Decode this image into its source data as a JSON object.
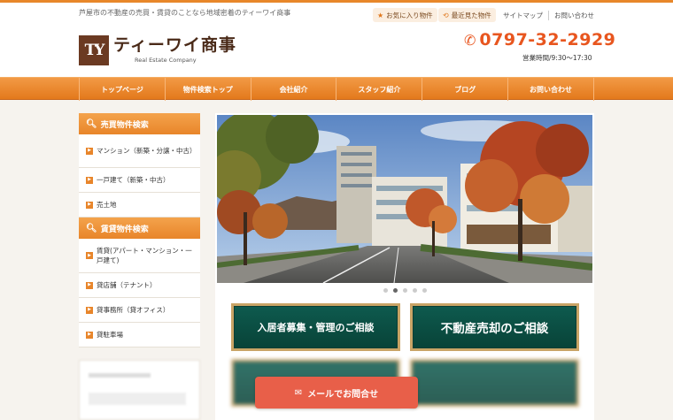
{
  "header": {
    "tagline": "芦屋市の不動産の売買・賃貸のことなら地域密着のティーワイ商事",
    "logo_mark": "TY",
    "logo_name": "ティーワイ商事",
    "logo_sub": "Real Estate Company",
    "utility": {
      "favorites": "お気に入り物件",
      "recent": "最近見た物件",
      "sitemap": "サイトマップ",
      "contact": "お問い合わせ"
    },
    "phone": "0797-32-2929",
    "hours": "営業時間/9:30～17:30"
  },
  "nav": [
    "トップページ",
    "物件検索トップ",
    "会社紹介",
    "スタッフ紹介",
    "ブログ",
    "お問い合わせ"
  ],
  "sidebar": {
    "sale_heading": "売買物件検索",
    "sale_items": [
      "マンション（新築・分譲・中古）",
      "一戸建て（新築・中古）",
      "売土地"
    ],
    "rent_heading": "賃貸物件検索",
    "rent_items": [
      "賃貸(アパート・マンション・一戸建て)",
      "貸店舗（テナント）",
      "貸事務所（貸オフィス）",
      "貸駐車場"
    ]
  },
  "slider": {
    "dot_count": 5,
    "active_dot": 2
  },
  "banners": {
    "tenant": "入居者募集・管理のご相談",
    "sell": "不動産売却のご相談"
  },
  "mail_button": "メールでお問合せ",
  "colors": {
    "accent": "#e8852a",
    "phone": "#e8561f",
    "banner_green": "#0e5a4e",
    "mail_button": "#e85f49"
  }
}
